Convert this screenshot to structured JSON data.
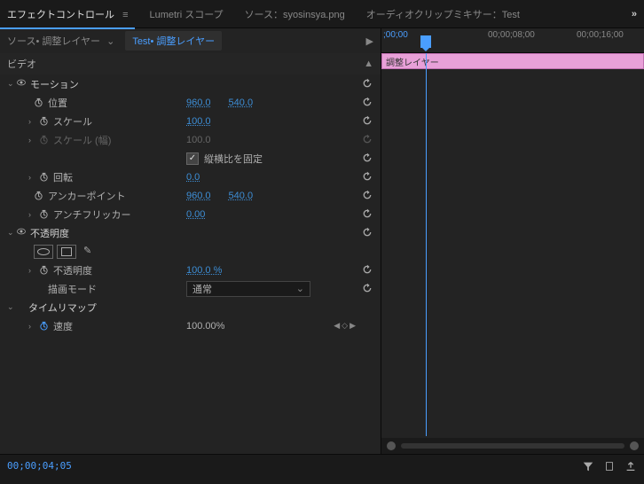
{
  "tabs": {
    "effect_controls": "エフェクトコントロール",
    "lumetri": "Lumetri スコープ",
    "source": "ソース：syosinsya.png",
    "audio_mixer": "オーディオクリップミキサー：Test"
  },
  "source_tabs": {
    "source": "ソース• 調整レイヤー",
    "active_prefix": "Test• ",
    "active_name": "調整レイヤー"
  },
  "section": {
    "video": "ビデオ"
  },
  "motion": {
    "title": "モーション",
    "position": "位置",
    "pos_x": "960.0",
    "pos_y": "540.0",
    "scale": "スケール",
    "scale_v": "100.0",
    "scale_w": "スケール (幅)",
    "scale_w_v": "100.0",
    "lock_aspect": "縦横比を固定",
    "rotation": "回転",
    "rotation_v": "0.0",
    "anchor": "アンカーポイント",
    "anchor_x": "960.0",
    "anchor_y": "540.0",
    "antiflicker": "アンチフリッカー",
    "antiflicker_v": "0.00"
  },
  "opacity": {
    "title": "不透明度",
    "opacity": "不透明度",
    "opacity_v": "100.0 %",
    "blend": "描画モード",
    "blend_v": "通常"
  },
  "timeremap": {
    "title": "タイムリマップ",
    "speed": "速度",
    "speed_v": "100.00%"
  },
  "timeline": {
    "t0": ";00;00",
    "t1": "00;00;08;00",
    "t2": "00;00;16;00",
    "clip_name": "調整レイヤー"
  },
  "footer": {
    "timecode": "00;00;04;05"
  }
}
